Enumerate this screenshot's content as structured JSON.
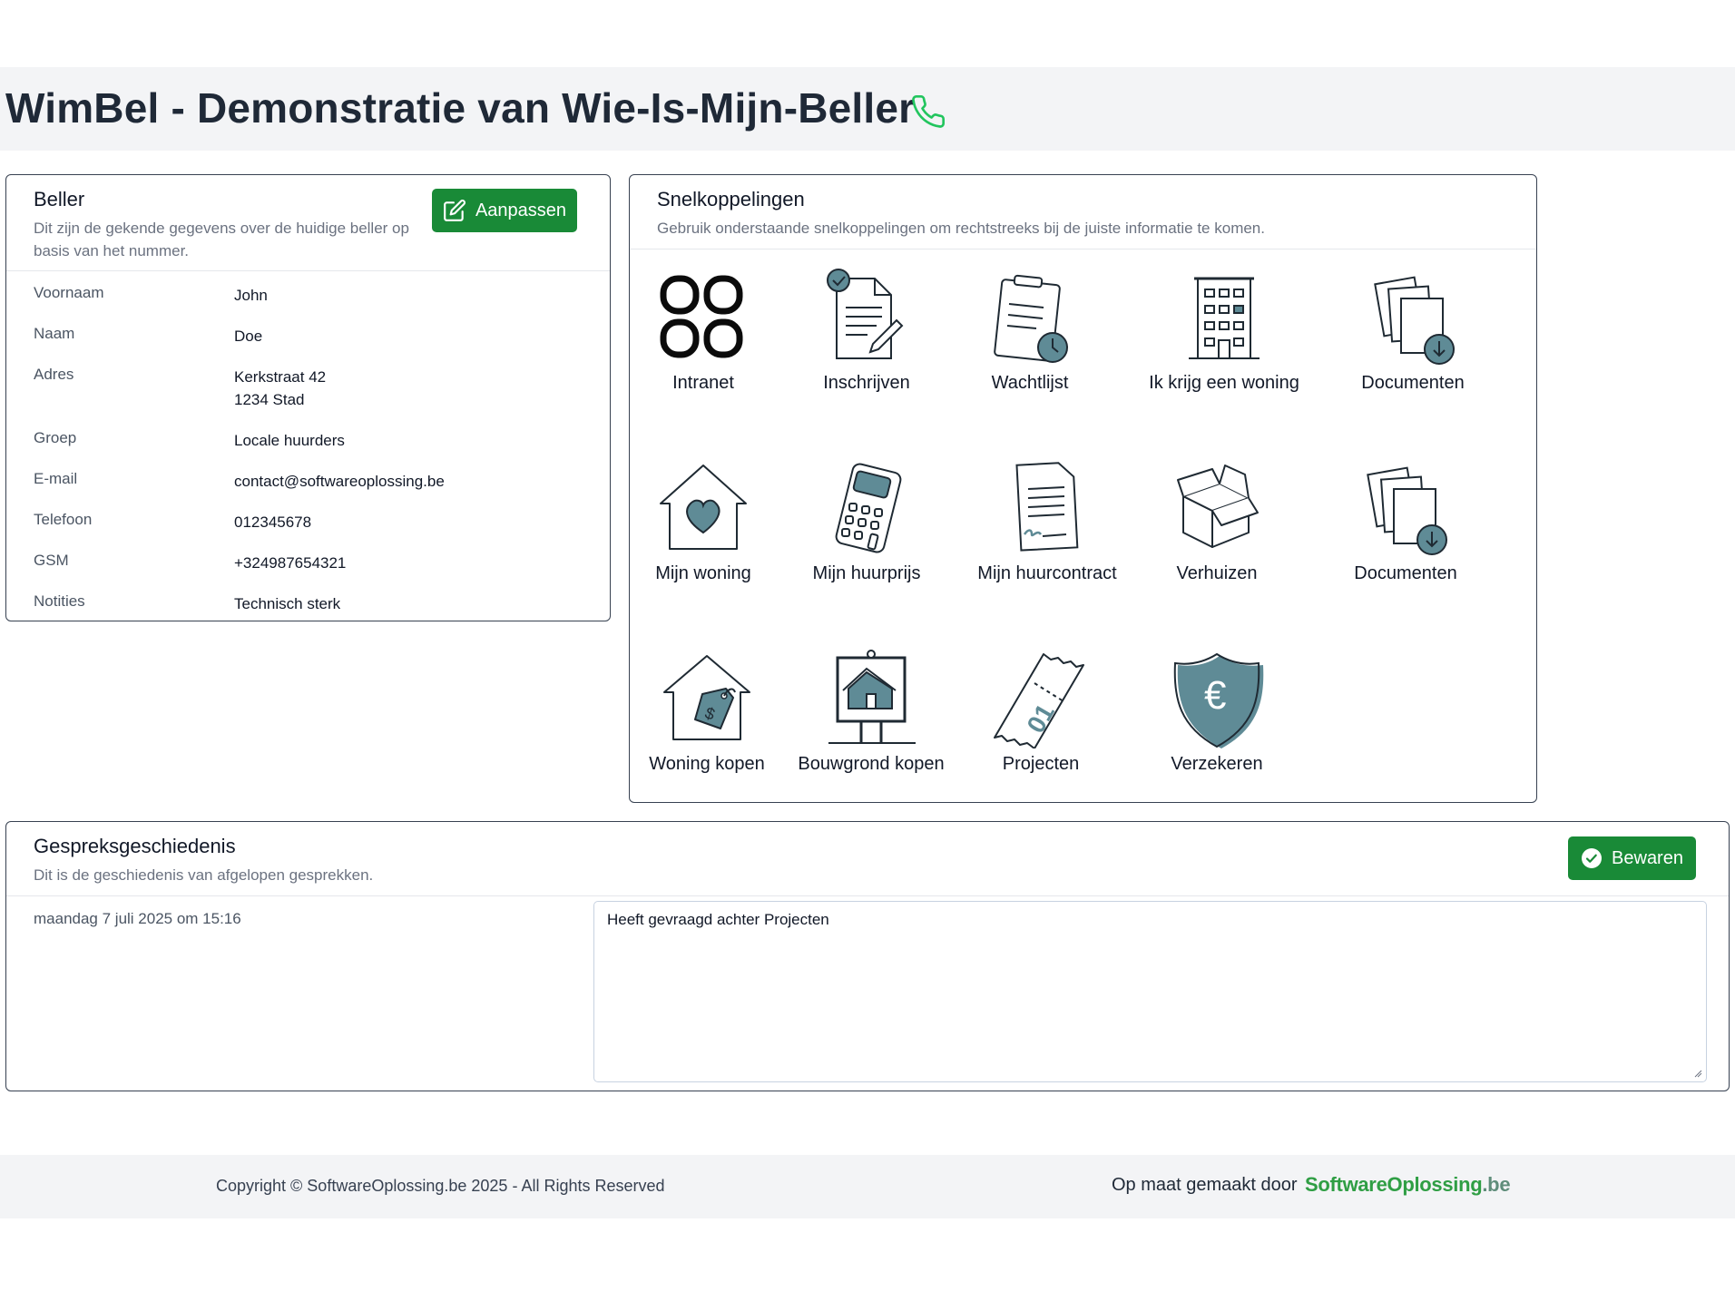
{
  "page": {
    "title": "WimBel - Demonstratie van Wie-Is-Mijn-Beller"
  },
  "colors": {
    "accent_green": "#198a37",
    "phone_icon": "#22c55e",
    "icon_fill": "#5f8b96",
    "icon_stroke": "#1f2a33"
  },
  "beller": {
    "title": "Beller",
    "subtitle": "Dit zijn de gekende gegevens over de huidige beller op basis van het nummer.",
    "edit_button": "Aanpassen",
    "fields": [
      {
        "label": "Voornaam",
        "value": "John"
      },
      {
        "label": "Naam",
        "value": "Doe"
      },
      {
        "label": "Adres",
        "value": "Kerkstraat 42\n1234 Stad"
      },
      {
        "label": "Groep",
        "value": "Locale huurders"
      },
      {
        "label": "E-mail",
        "value": "contact@softwareoplossing.be"
      },
      {
        "label": "Telefoon",
        "value": "012345678"
      },
      {
        "label": "GSM",
        "value": "+324987654321"
      },
      {
        "label": "Notities",
        "value": "Technisch sterk"
      }
    ]
  },
  "shortcuts": {
    "title": "Snelkoppelingen",
    "subtitle": "Gebruik onderstaande snelkoppelingen om rechtstreeks bij de juiste informatie te komen.",
    "items": [
      {
        "label": "Intranet",
        "icon": "grid-icon"
      },
      {
        "label": "Inschrijven",
        "icon": "signup-document-icon"
      },
      {
        "label": "Wachtlijst",
        "icon": "clipboard-clock-icon"
      },
      {
        "label": "Ik krijg een woning",
        "icon": "apartment-building-icon"
      },
      {
        "label": "Documenten",
        "icon": "documents-download-icon"
      },
      {
        "label": "Mijn woning",
        "icon": "house-heart-icon"
      },
      {
        "label": "Mijn huurprijs",
        "icon": "calculator-icon"
      },
      {
        "label": "Mijn huurcontract",
        "icon": "contract-icon"
      },
      {
        "label": "Verhuizen",
        "icon": "moving-box-icon"
      },
      {
        "label": "Documenten",
        "icon": "documents-download-icon"
      },
      {
        "label": "Woning kopen",
        "icon": "house-price-tag-icon"
      },
      {
        "label": "Bouwgrond kopen",
        "icon": "land-sign-icon"
      },
      {
        "label": "Projecten",
        "icon": "ticket-icon"
      },
      {
        "label": "Verzekeren",
        "icon": "euro-shield-icon"
      }
    ]
  },
  "history": {
    "title": "Gespreksgeschiedenis",
    "subtitle": "Dit is de geschiedenis van afgelopen gesprekken.",
    "save_button": "Bewaren",
    "entries": [
      {
        "date": "maandag 7 juli 2025 om 15:16",
        "note": "Heeft gevraagd achter Projecten"
      }
    ]
  },
  "footer": {
    "copyright": "Copyright © SoftwareOplossing.be 2025 - All Rights Reserved",
    "made_by": "Op maat gemaakt door",
    "brand_part1": "SoftwareOplossing",
    "brand_part2": ".be"
  }
}
